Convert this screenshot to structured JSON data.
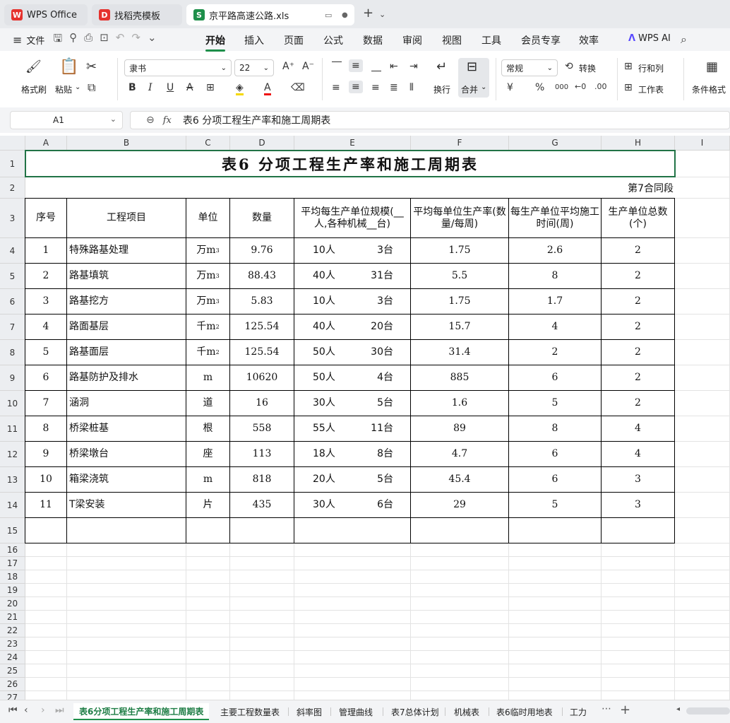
{
  "tabs": [
    {
      "label": "WPS Office",
      "icon": "wps-logo-icon",
      "color": "#e5322d"
    },
    {
      "label": "找稻壳模板",
      "icon": "docer-icon",
      "color": "#e5322d"
    },
    {
      "label": "京平路高速公路.xls",
      "icon": "spreadsheet-icon",
      "color": "#1e8f4a"
    }
  ],
  "menu": {
    "file": "文件",
    "items": [
      "开始",
      "插入",
      "页面",
      "公式",
      "数据",
      "审阅",
      "视图",
      "工具",
      "会员专享",
      "效率"
    ],
    "active": "开始",
    "ai": "WPS AI"
  },
  "ribbon": {
    "format_painter": "格式刷",
    "paste": "粘贴",
    "font_name": "隶书",
    "font_size": "22",
    "wrap": "换行",
    "merge": "合并",
    "number_format": "常规",
    "convert": "转换",
    "row_col": "行和列",
    "worksheet": "工作表",
    "cond_format": "条件格式",
    "currency": "¥",
    "percent": "%",
    "thousands": "000",
    "accent": "#1e8f4a"
  },
  "formula_bar": {
    "cell_ref": "A1",
    "fx": "fx",
    "content": "表6   分项工程生产率和施工周期表"
  },
  "columns": [
    "A",
    "B",
    "C",
    "D",
    "E",
    "F",
    "G",
    "H",
    "I"
  ],
  "rows": [
    "1",
    "2",
    "3",
    "4",
    "5",
    "6",
    "7",
    "8",
    "9",
    "10",
    "11",
    "12",
    "13",
    "14",
    "15",
    "16",
    "17",
    "18",
    "19",
    "20",
    "21",
    "22",
    "23",
    "24",
    "25",
    "26",
    "27"
  ],
  "sheet": {
    "title": "表6   分项工程生产率和施工周期表",
    "section": "第7合同段",
    "headers": [
      "序号",
      "工程项目",
      "单位",
      "数量",
      "平均每生产单位规模(__人,各种机械__台)",
      "平均每单位生产率(数量/每周)",
      "每生产单位平均施工时间(周)",
      "生产单位总数(个)"
    ],
    "data": [
      {
        "no": "1",
        "item": "特殊路基处理",
        "unit": "万m",
        "unit_sup": "3",
        "qty": "9.76",
        "people": "10人",
        "machines": "3台",
        "rate": "1.75",
        "time": "2.6",
        "count": "2"
      },
      {
        "no": "2",
        "item": "路基填筑",
        "unit": "万m",
        "unit_sup": "3",
        "qty": "88.43",
        "people": "40人",
        "machines": "31台",
        "rate": "5.5",
        "time": "8",
        "count": "2"
      },
      {
        "no": "3",
        "item": "路基挖方",
        "unit": "万m",
        "unit_sup": "3",
        "qty": "5.83",
        "people": "10人",
        "machines": "3台",
        "rate": "1.75",
        "time": "1.7",
        "count": "2"
      },
      {
        "no": "4",
        "item": "路面基层",
        "unit": "千m",
        "unit_sup": "2",
        "qty": "125.54",
        "people": "40人",
        "machines": "20台",
        "rate": "15.7",
        "time": "4",
        "count": "2"
      },
      {
        "no": "5",
        "item": "路基面层",
        "unit": "千m",
        "unit_sup": "2",
        "qty": "125.54",
        "people": "50人",
        "machines": "30台",
        "rate": "31.4",
        "time": "2",
        "count": "2"
      },
      {
        "no": "6",
        "item": "路基防护及排水",
        "unit": "m",
        "unit_sup": "",
        "qty": "10620",
        "people": "50人",
        "machines": "4台",
        "rate": "885",
        "time": "6",
        "count": "2"
      },
      {
        "no": "7",
        "item": "涵洞",
        "unit": "道",
        "unit_sup": "",
        "qty": "16",
        "people": "30人",
        "machines": "5台",
        "rate": "1.6",
        "time": "5",
        "count": "2"
      },
      {
        "no": "8",
        "item": "桥梁桩基",
        "unit": "根",
        "unit_sup": "",
        "qty": "558",
        "people": "55人",
        "machines": "11台",
        "rate": "89",
        "time": "8",
        "count": "4"
      },
      {
        "no": "9",
        "item": "桥梁墩台",
        "unit": "座",
        "unit_sup": "",
        "qty": "113",
        "people": "18人",
        "machines": "8台",
        "rate": "4.7",
        "time": "6",
        "count": "4"
      },
      {
        "no": "10",
        "item": "箱梁浇筑",
        "unit": "m",
        "unit_sup": "",
        "qty": "818",
        "people": "20人",
        "machines": "5台",
        "rate": "45.4",
        "time": "6",
        "count": "3"
      },
      {
        "no": "11",
        "item": "T梁安装",
        "unit": "片",
        "unit_sup": "",
        "qty": "435",
        "people": "30人",
        "machines": "6台",
        "rate": "29",
        "time": "5",
        "count": "3"
      }
    ]
  },
  "sheet_tabs": [
    "表6分项工程生产率和施工周期表",
    "主要工程数量表",
    "斜率图",
    "管理曲线",
    "表7总体计划",
    "机械表",
    "表6临时用地表",
    "工力"
  ],
  "active_sheet": "表6分项工程生产率和施工周期表"
}
